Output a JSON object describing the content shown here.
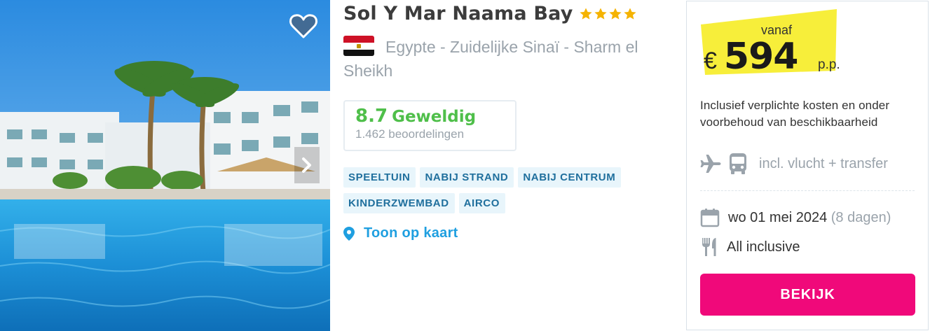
{
  "hotel": {
    "name": "Sol Y Mar Naama Bay",
    "stars": 4,
    "location": "Egypte - Zuidelijke Sinaï - Sharm el Sheikh",
    "flag": "egypt-flag"
  },
  "rating": {
    "score": "8.7",
    "label": "Geweldig",
    "count": "1.462 beoordelingen"
  },
  "tags": [
    "SPEELTUIN",
    "NABIJ STRAND",
    "NABIJ CENTRUM",
    "KINDERZWEMBAD",
    "AIRCO"
  ],
  "map_link": {
    "label": "Toon op kaart",
    "icon": "map-pin-icon"
  },
  "price": {
    "prefix": "vanaf",
    "currency": "€",
    "amount": "594",
    "suffix": "p.p."
  },
  "disclaimer": "Inclusief verplichte kosten en onder voorbehoud van beschikbaarheid",
  "transport": {
    "label": "incl. vlucht + transfer",
    "icons": [
      "plane-icon",
      "bus-icon"
    ]
  },
  "departure": {
    "date": "wo 01 mei 2024",
    "duration": "(8 dagen)"
  },
  "board": {
    "label": "All inclusive"
  },
  "cta": {
    "label": "BEKIJK"
  },
  "colors": {
    "accent": "#f0097a",
    "rating_green": "#4fbf4a",
    "tag_bg": "#e8f5fb",
    "tag_text": "#1f6f9d",
    "link_blue": "#1f9fe0",
    "price_badge": "#f7ee3a",
    "star": "#f5b301"
  }
}
